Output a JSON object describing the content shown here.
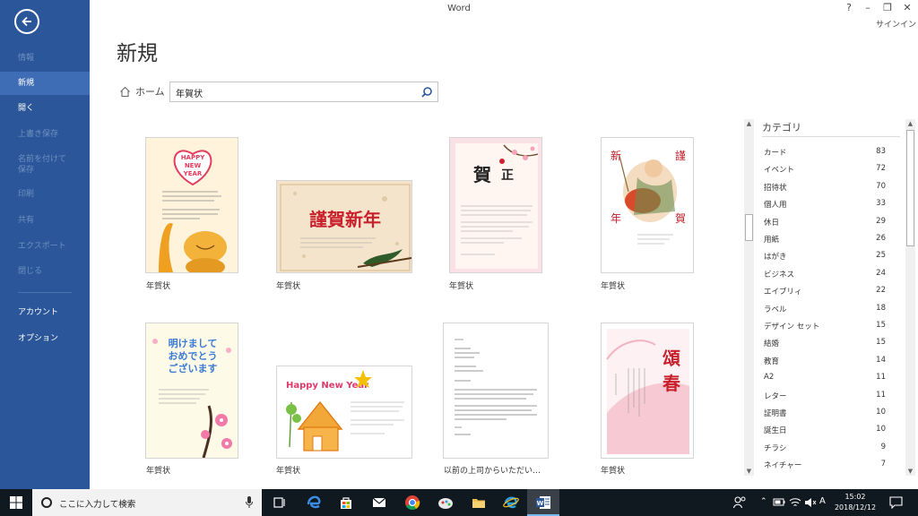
{
  "window": {
    "title": "Word",
    "help": "?",
    "minimize": "–",
    "restore": "❐",
    "close": "✕",
    "signin": "サインイン"
  },
  "sidebar": {
    "items": [
      {
        "label": "情報",
        "enabled": false
      },
      {
        "label": "新規",
        "enabled": true,
        "active": true
      },
      {
        "label": "開く",
        "enabled": true
      },
      {
        "label": "上書き保存",
        "enabled": false
      },
      {
        "label": "名前を付けて保存",
        "enabled": false
      },
      {
        "label": "印刷",
        "enabled": false
      },
      {
        "label": "共有",
        "enabled": false
      },
      {
        "label": "エクスポート",
        "enabled": false
      },
      {
        "label": "閉じる",
        "enabled": false
      },
      {
        "label": "アカウント",
        "enabled": true
      },
      {
        "label": "オプション",
        "enabled": true
      }
    ]
  },
  "main": {
    "title": "新規",
    "home_label": "ホーム",
    "search_value": "年賀状"
  },
  "templates": [
    {
      "label": "年賀状",
      "art": "HAPPY NEW YEAR"
    },
    {
      "label": "年賀状",
      "art": "謹賀新年"
    },
    {
      "label": "年賀状",
      "art": "賀正"
    },
    {
      "label": "年賀状",
      "art": [
        "新",
        "謹",
        "年",
        "賀"
      ]
    },
    {
      "label": "年賀状",
      "art": "明けましておめでとうございます"
    },
    {
      "label": "年賀状",
      "art": "Happy New Year"
    },
    {
      "label": "以前の上司からいただい…",
      "art": ""
    },
    {
      "label": "年賀状",
      "art": "頌春"
    }
  ],
  "categories_title": "カテゴリ",
  "categories": [
    {
      "name": "カード",
      "count": "83"
    },
    {
      "name": "イベント",
      "count": "72"
    },
    {
      "name": "招待状",
      "count": "70"
    },
    {
      "name": "個人用",
      "count": "33"
    },
    {
      "name": "休日",
      "count": "29"
    },
    {
      "name": "用紙",
      "count": "26"
    },
    {
      "name": "はがき",
      "count": "25"
    },
    {
      "name": "ビジネス",
      "count": "24"
    },
    {
      "name": "エイブリィ",
      "count": "22"
    },
    {
      "name": "ラベル",
      "count": "18"
    },
    {
      "name": "デザイン セット",
      "count": "15"
    },
    {
      "name": "結婚",
      "count": "15"
    },
    {
      "name": "教育",
      "count": "14"
    },
    {
      "name": "A2",
      "count": "11"
    },
    {
      "name": "レター",
      "count": "11"
    },
    {
      "name": "証明書",
      "count": "10"
    },
    {
      "name": "誕生日",
      "count": "10"
    },
    {
      "name": "チラシ",
      "count": "9"
    },
    {
      "name": "ネイチャー",
      "count": "7"
    }
  ],
  "taskbar": {
    "search_placeholder": "ここに入力して検索",
    "time": "15:02",
    "date": "2018/12/12",
    "ime": "A"
  },
  "colors": {
    "sidebar": "#2b579a",
    "sidebar_active": "#3e6db5",
    "taskbar": "#101820"
  }
}
